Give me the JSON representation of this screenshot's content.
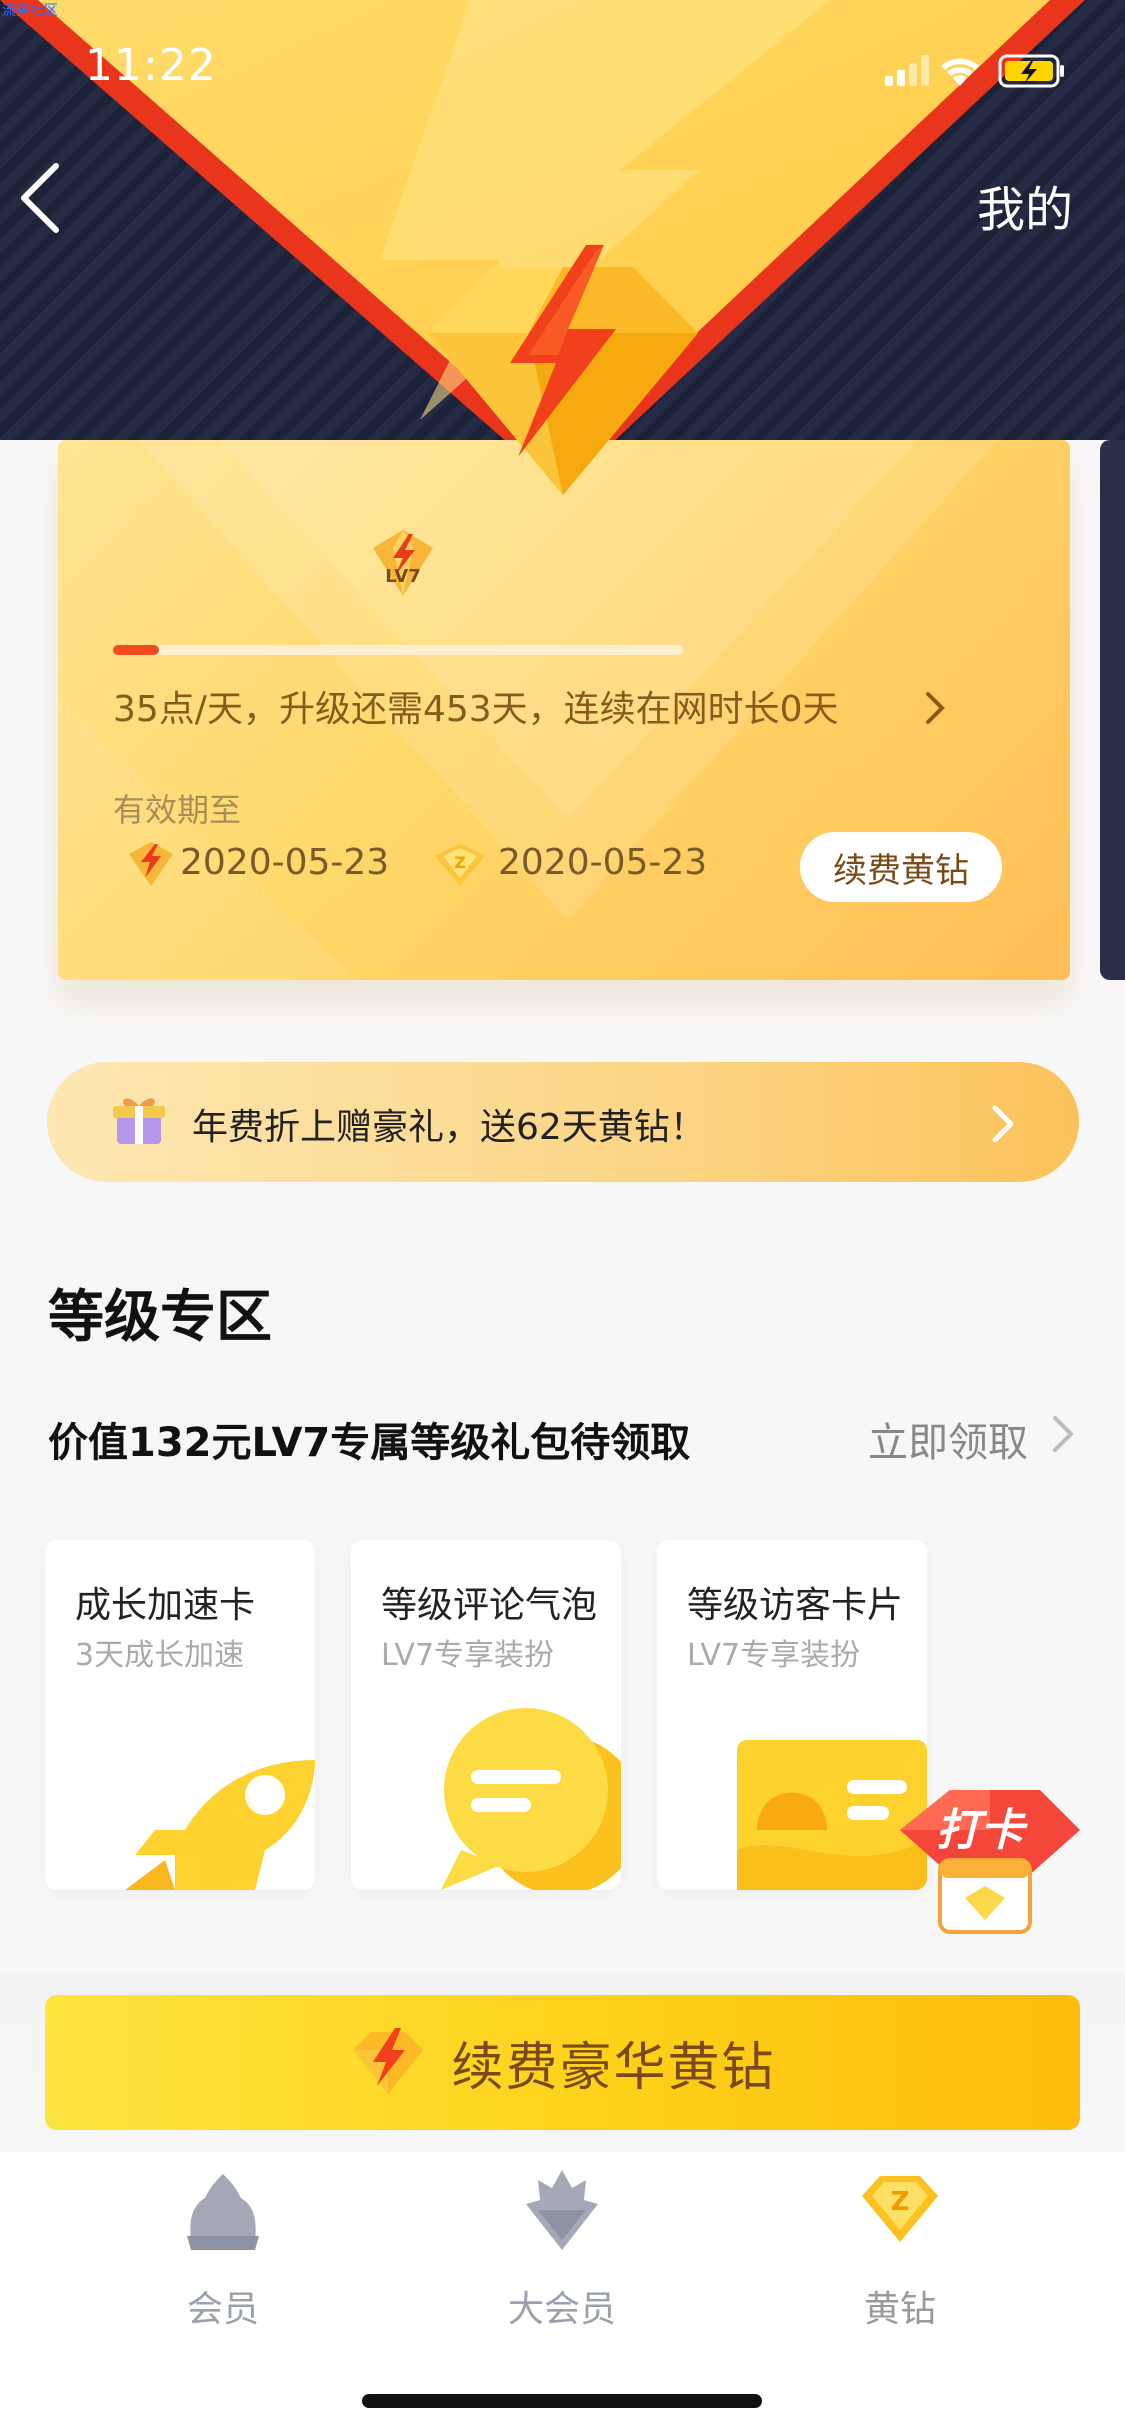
{
  "watermark": "流星社区",
  "status_bar": {
    "time": "11:22"
  },
  "header": {
    "right_link": "我的"
  },
  "card": {
    "level_badge": "LV7",
    "progress": 0.08,
    "description": "35点/天，升级还需453天，连续在网时长0天",
    "valid_label": "有效期至",
    "expiry_1": "2020-05-23",
    "expiry_2": "2020-05-23",
    "renew_label": "续费黄钻"
  },
  "promo": {
    "text": "年费折上赠豪礼，送62天黄钻！"
  },
  "level_section": {
    "title": "等级专区",
    "gift_title": "价值132元LV7专属等级礼包待领取",
    "claim_label": "立即领取",
    "perks": [
      {
        "title": "成长加速卡",
        "subtitle": "3天成长加速",
        "icon": "rocket-icon"
      },
      {
        "title": "等级评论气泡",
        "subtitle": "LV7专享装扮",
        "icon": "chat-bubble-icon"
      },
      {
        "title": "等级访客卡片",
        "subtitle": "LV7专享装扮",
        "icon": "visitor-card-icon"
      }
    ],
    "checkin_label": "打卡"
  },
  "main_button": {
    "label": "续费豪华黄钻"
  },
  "tabbar": {
    "items": [
      {
        "label": "会员",
        "icon": "member-icon"
      },
      {
        "label": "大会员",
        "icon": "big-member-icon"
      },
      {
        "label": "黄钻",
        "icon": "yellow-diamond-icon"
      }
    ],
    "active_index": 2
  },
  "colors": {
    "card_gold": "#ffd86a",
    "progress_red": "#f04b1e",
    "header_navy": "#1c2238",
    "text_brown": "#8a5a1c"
  }
}
